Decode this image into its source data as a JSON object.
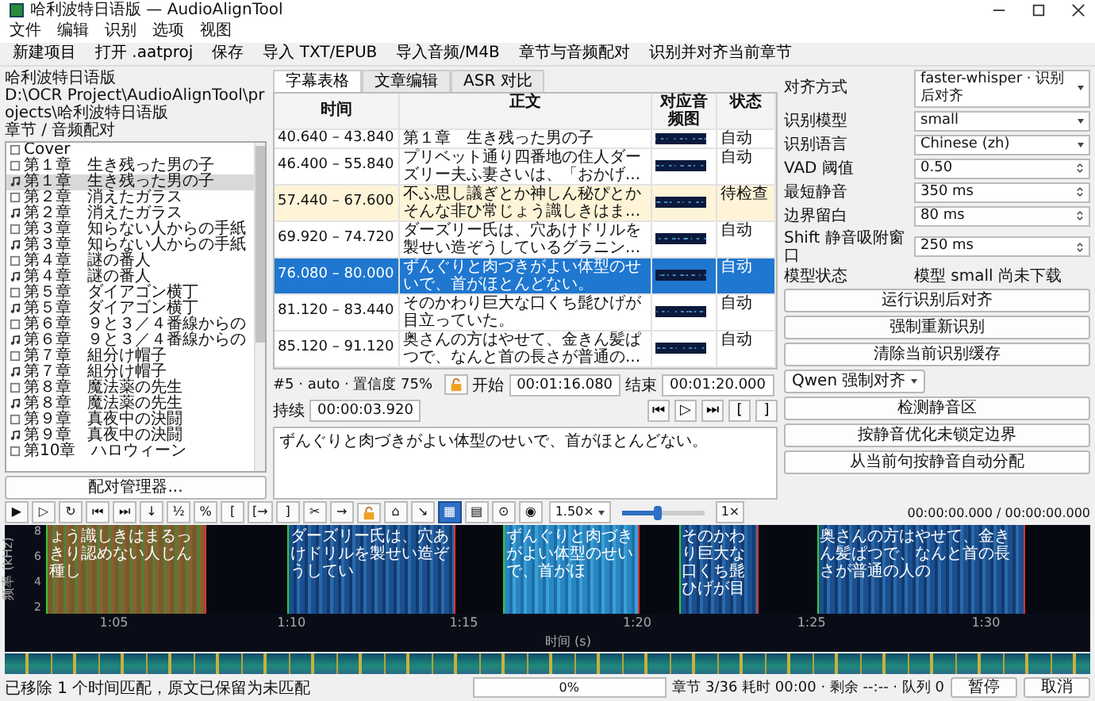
{
  "window": {
    "title": "哈利波特日语版 — AudioAlignTool"
  },
  "menu": [
    "文件",
    "编辑",
    "识别",
    "选项",
    "视图"
  ],
  "toolbar": [
    "新建项目",
    "打开 .aatproj",
    "保存",
    "导入 TXT/EPUB",
    "导入音频/M4B",
    "章节与音频配对",
    "识别并对齐当前章节"
  ],
  "project": {
    "name": "哈利波特日语版",
    "path": "D:\\OCR Project\\AudioAlignTool\\projects\\哈利波特日语版",
    "list_label": "章节 / 音频配对",
    "manager_button": "配对管理器...",
    "chapters": [
      {
        "kind": "text",
        "label": "Cover",
        "selected": false
      },
      {
        "kind": "text",
        "label": "第１章　生き残った男の子",
        "selected": false
      },
      {
        "kind": "audio",
        "label": "第１章　生き残った男の子",
        "selected": true
      },
      {
        "kind": "text",
        "label": "第２章　消えたガラス",
        "selected": false
      },
      {
        "kind": "audio",
        "label": "第２章　消えたガラス",
        "selected": false
      },
      {
        "kind": "text",
        "label": "第３章　知らない人からの手紙",
        "selected": false
      },
      {
        "kind": "audio",
        "label": "第３章　知らない人からの手紙",
        "selected": false
      },
      {
        "kind": "text",
        "label": "第４章　謎の番人",
        "selected": false
      },
      {
        "kind": "audio",
        "label": "第４章　謎の番人",
        "selected": false
      },
      {
        "kind": "text",
        "label": "第５章　ダイアゴン横丁",
        "selected": false
      },
      {
        "kind": "audio",
        "label": "第５章　ダイアゴン横丁",
        "selected": false
      },
      {
        "kind": "text",
        "label": "第６章　９と３／４番線からの",
        "selected": false
      },
      {
        "kind": "audio",
        "label": "第６章　９と３／４番線からの",
        "selected": false
      },
      {
        "kind": "text",
        "label": "第７章　組分け帽子",
        "selected": false
      },
      {
        "kind": "audio",
        "label": "第７章　組分け帽子",
        "selected": false
      },
      {
        "kind": "text",
        "label": "第８章　魔法薬の先生",
        "selected": false
      },
      {
        "kind": "audio",
        "label": "第８章　魔法薬の先生",
        "selected": false
      },
      {
        "kind": "text",
        "label": "第９章　真夜中の決闘",
        "selected": false
      },
      {
        "kind": "audio",
        "label": "第９章　真夜中の決闘",
        "selected": false
      },
      {
        "kind": "text",
        "label": "第10章　ハロウィーン",
        "selected": false
      }
    ]
  },
  "tabs": [
    {
      "label": "字幕表格",
      "selected": true
    },
    {
      "label": "文章编辑",
      "selected": false
    },
    {
      "label": "ASR 对比",
      "selected": false
    }
  ],
  "table": {
    "columns": [
      "时间",
      "正文",
      "对应音频图",
      "状态"
    ],
    "rows": [
      {
        "time": "40.640 – 43.840",
        "text": "第１章　生き残った男の子",
        "status": "自动",
        "flagged": false,
        "selected": false
      },
      {
        "time": "46.400 – 55.840",
        "text": "プリベット通り四番地の住人ダーズリー夫ふ妻さいは、「おかげ...",
        "status": "自动",
        "flagged": false,
        "selected": false
      },
      {
        "time": "57.440 – 67.600",
        "text": "不ふ思し議ぎとか神しん秘ぴとかそんな非ひ常じょう識しきはま...",
        "status": "待检查",
        "flagged": true,
        "selected": false
      },
      {
        "time": "69.920 – 74.720",
        "text": "ダーズリー氏は、穴あけドリルを製せい造ぞうしているグラニン...",
        "status": "自动",
        "flagged": false,
        "selected": false
      },
      {
        "time": "76.080 – 80.000",
        "text": "ずんぐりと肉づきがよい体型のせいで、首がほとんどない。",
        "status": "自动",
        "flagged": false,
        "selected": true
      },
      {
        "time": "81.120 – 83.440",
        "text": "そのかわり巨大な口くち髭ひげが目立っていた。",
        "status": "自动",
        "flagged": false,
        "selected": false
      },
      {
        "time": "85.120 – 91.120",
        "text": "奥さんの方はやせて、金きん髪ぱつで、なんと首の長さが普通の...",
        "status": "自动",
        "flagged": false,
        "selected": false
      }
    ]
  },
  "detail": {
    "info": "#5 · auto · 置信度 75%",
    "start_label": "开始",
    "start": "00:01:16.080",
    "end_label": "结束",
    "end": "00:01:20.000",
    "duration_label": "持续",
    "duration": "00:00:03.920",
    "transport": [
      "⏮",
      "▷",
      "⏭",
      "[",
      "]"
    ]
  },
  "text_editor": {
    "value": "ずんぐりと肉づきがよい体型のせいで、首がほとんどない。"
  },
  "settings": {
    "fields": [
      {
        "kind": "select",
        "label": "对齐方式",
        "value": "faster-whisper · 识别后对齐"
      },
      {
        "kind": "select",
        "label": "识别模型",
        "value": "small"
      },
      {
        "kind": "select",
        "label": "识别语言",
        "value": "Chinese (zh)"
      },
      {
        "kind": "spin",
        "label": "VAD 阈值",
        "value": "0.50"
      },
      {
        "kind": "spin",
        "label": "最短静音",
        "value": "350 ms"
      },
      {
        "kind": "spin",
        "label": "边界留白",
        "value": "80 ms"
      },
      {
        "kind": "spin",
        "label": "Shift 静音吸附窗口",
        "value": "250 ms"
      },
      {
        "kind": "text",
        "label": "模型状态",
        "value": "模型 small 尚未下载"
      }
    ],
    "actions": [
      {
        "kind": "button",
        "label": "运行识别后对齐"
      },
      {
        "kind": "button",
        "label": "强制重新识别"
      },
      {
        "kind": "button",
        "label": "清除当前识别缓存"
      },
      {
        "kind": "dropdown",
        "label": "Qwen 强制对齐"
      },
      {
        "kind": "button",
        "label": "检测静音区"
      },
      {
        "kind": "button",
        "label": "按静音优化未锁定边界"
      },
      {
        "kind": "button",
        "label": "从当前句按静音自动分配"
      }
    ]
  },
  "player": {
    "tools": [
      {
        "kind": "glyph",
        "label": "▶",
        "selected": false
      },
      {
        "kind": "glyph",
        "label": "▷",
        "selected": false
      },
      {
        "kind": "glyph",
        "label": "↻",
        "selected": false
      },
      {
        "kind": "glyph",
        "label": "⏮",
        "selected": false
      },
      {
        "kind": "glyph",
        "label": "⏭",
        "selected": false
      },
      {
        "kind": "glyph",
        "label": "↓",
        "selected": false
      },
      {
        "kind": "glyph",
        "label": "½",
        "selected": false
      },
      {
        "kind": "glyph",
        "label": "%",
        "selected": false
      },
      {
        "kind": "glyph",
        "label": "[",
        "selected": false
      },
      {
        "kind": "glyph",
        "label": "[→",
        "selected": false
      },
      {
        "kind": "glyph",
        "label": "]",
        "selected": false
      },
      {
        "kind": "glyph",
        "label": "✂",
        "selected": false
      },
      {
        "kind": "glyph",
        "label": "→",
        "selected": false
      },
      {
        "kind": "lock",
        "selected": false
      },
      {
        "kind": "glyph",
        "label": "⌂",
        "selected": false
      },
      {
        "kind": "glyph",
        "label": "↘",
        "selected": false
      },
      {
        "kind": "glyph",
        "label": "▦",
        "selected": true
      },
      {
        "kind": "glyph",
        "label": "▤",
        "selected": false
      },
      {
        "kind": "glyph",
        "label": "⊙",
        "selected": false
      },
      {
        "kind": "glyph",
        "label": "◉",
        "selected": false
      }
    ],
    "speed": "1.50×",
    "volume": {
      "level": 0.42
    },
    "rate_button": "1×",
    "time": "00:00:00.000 / 00:00:00.000"
  },
  "spectrogram": {
    "ylabel": "频率 (kHz)",
    "yticks": [
      "8",
      "6",
      "4",
      "2"
    ],
    "xticks": [
      "1:05",
      "1:10",
      "1:15",
      "1:20",
      "1:25",
      "1:30"
    ],
    "xlabel": "时间 (s)",
    "segments": [
      {
        "text": "ょう識しきはまるっきり認めない人じん種し",
        "flagged": true,
        "selected": false
      },
      {
        "text": "ダーズリー氏は、穴あけドリルを製せい造ぞうしてい",
        "flagged": false,
        "selected": false
      },
      {
        "text": "ずんぐりと肉づきがよい体型のせいで、首がほ",
        "flagged": false,
        "selected": true
      },
      {
        "text": "そのかわり巨大な口くち髭ひげが目",
        "flagged": false,
        "selected": false
      },
      {
        "text": "奥さんの方はやせて、金きん髪ぱつで、なんと首の長さが普通の人の",
        "flagged": false,
        "selected": false
      }
    ]
  },
  "status_bar": {
    "message": "已移除 1 个时间匹配，原文已保留为未匹配",
    "progress": {
      "level": 0,
      "label": "0%"
    },
    "info": "章节 3/36  耗时 00:00 · 剩余 --:-- · 队列 0",
    "buttons": [
      "暂停",
      "取消"
    ]
  }
}
